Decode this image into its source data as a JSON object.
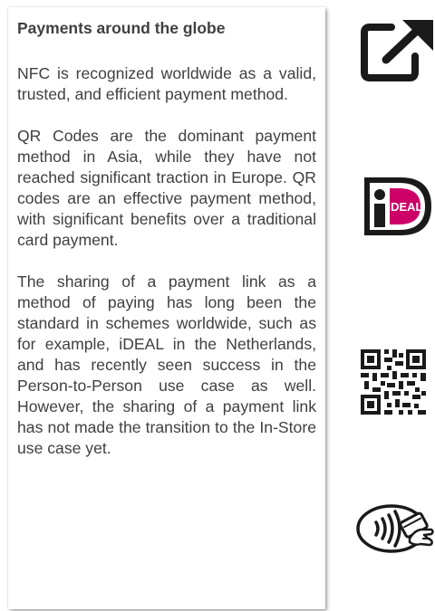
{
  "card": {
    "title": "Payments around the globe",
    "paragraphs": [
      "NFC is recognized worldwide as a valid, trusted, and efficient payment method.",
      "QR Codes are the dominant payment method in Asia, while they have not reached significant traction in Europe. QR codes are an effective payment method, with significant benefits over a traditional card payment.",
      "The sharing of a payment link as a method of paying has long been the standard in schemes worldwide, such as for example, iDEAL in the Netherlands, and has recently seen success in the Person-to-Person use case as well. However, the sharing of a payment link has not made the transition to the In-Store use case yet."
    ]
  },
  "icons": {
    "open_link": "external-link-icon",
    "ideal": "ideal-logo",
    "ideal_text": "iDEAL",
    "qr": "qr-code-icon",
    "nfc": "contactless-payment-icon"
  },
  "colors": {
    "text": "#404040",
    "icon": "#1a1a1a",
    "ideal_pink": "#cc0066"
  }
}
